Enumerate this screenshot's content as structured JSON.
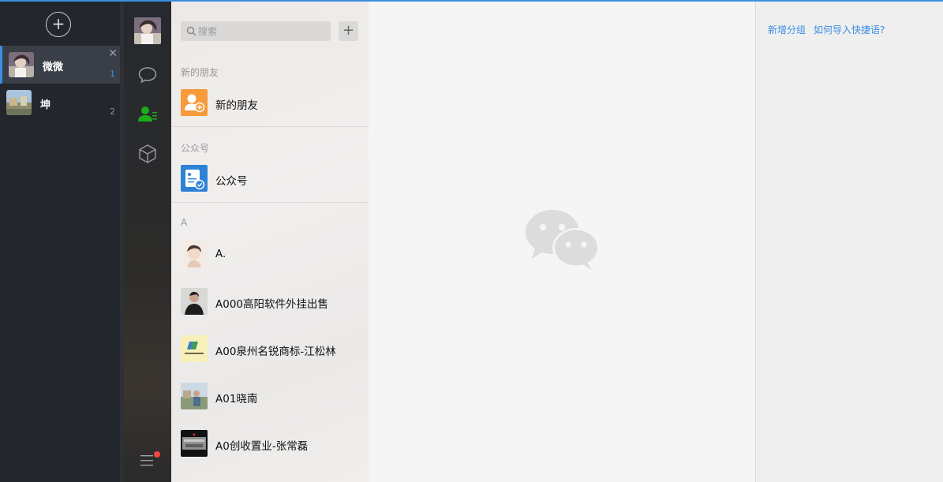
{
  "accounts": {
    "add_symbol": "+",
    "items": [
      {
        "name": "微微",
        "count": "1",
        "close": "✕"
      },
      {
        "name": "坤",
        "count": "2"
      }
    ]
  },
  "sidebar": {
    "nav_icons": [
      "chat-bubble-icon",
      "contacts-icon",
      "cube-icon",
      "menu-icon"
    ],
    "active_color": "#1aad19"
  },
  "search": {
    "placeholder": "搜索",
    "plus": "+"
  },
  "contacts": {
    "sections": [
      {
        "header": "新的朋友",
        "items": [
          {
            "name": "新的朋友"
          }
        ]
      },
      {
        "header": "公众号",
        "items": [
          {
            "name": "公众号"
          }
        ]
      },
      {
        "header": "A",
        "items": [
          {
            "name": "A."
          },
          {
            "name": "A000高阳软件外挂出售"
          },
          {
            "name": "A00泉州名锐商标-江松林"
          },
          {
            "name": "A01晓南"
          },
          {
            "name": "A0创收置业-张常磊"
          }
        ]
      }
    ]
  },
  "right_panel": {
    "add_group_link": "新增分组",
    "import_link": "如何导入快捷语?"
  },
  "colors": {
    "accent": "#3a8ee6",
    "wechat_green": "#1aad19",
    "badge_red": "#f2483f"
  }
}
